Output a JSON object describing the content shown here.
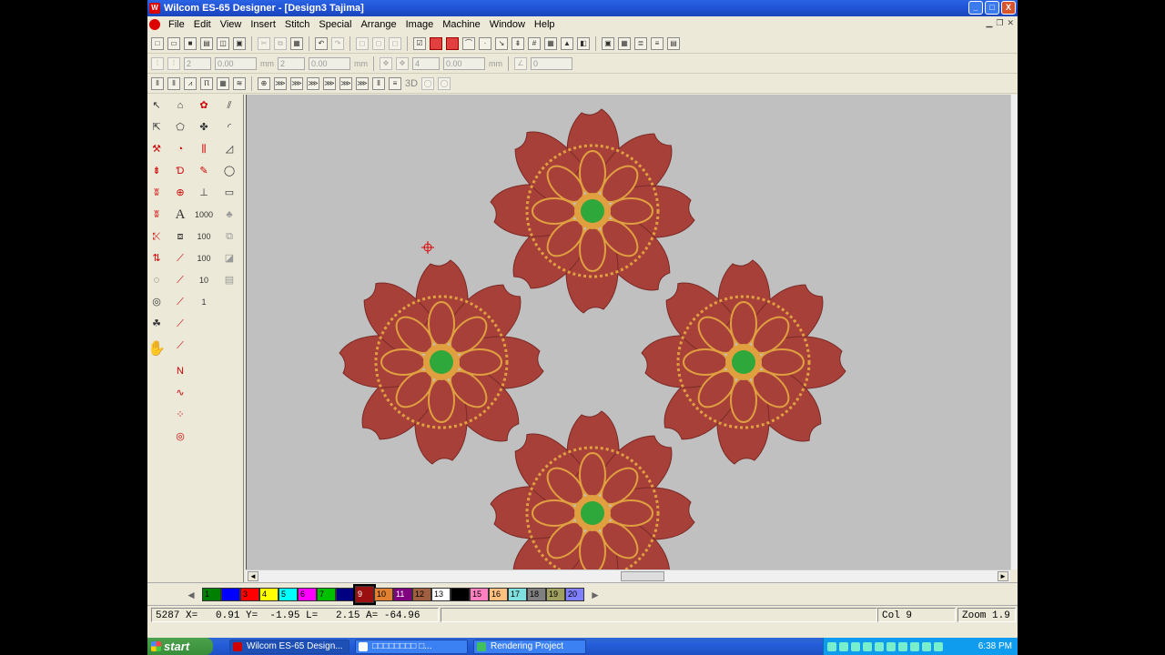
{
  "window": {
    "title": "Wilcom ES-65 Designer - [Design3        Tajima]",
    "minimize": "_",
    "maximize": "□",
    "close": "X"
  },
  "menu": [
    "File",
    "Edit",
    "View",
    "Insert",
    "Stitch",
    "Special",
    "Arrange",
    "Image",
    "Machine",
    "Window",
    "Help"
  ],
  "property_bar": {
    "spacing_1": "2",
    "length_1": "0.00",
    "unit_1": "mm",
    "spacing_2": "2",
    "length_2": "0.00",
    "unit_2": "mm",
    "spacing_3": "4",
    "length_3": "0.00",
    "unit_3": "mm",
    "angle": "0"
  },
  "stitch_toolbar": {
    "label_3d": "3D"
  },
  "toolbox": {
    "text_tool": "A",
    "count_1000": "1000",
    "count_100_a": "100",
    "count_100_b": "100",
    "count_10": "10",
    "count_1": "1"
  },
  "canvas": {
    "background": "#c0c0c0",
    "thread_red": "#a8403a",
    "thread_gold": "#e0a040",
    "thread_green": "#2ea83a"
  },
  "palette": {
    "swatches": [
      {
        "label": "1",
        "color": "#008000"
      },
      {
        "label": "",
        "color": "#0000ff"
      },
      {
        "label": "3",
        "color": "#ff0000"
      },
      {
        "label": "4",
        "color": "#ffff00"
      },
      {
        "label": "5",
        "color": "#00ffff"
      },
      {
        "label": "6",
        "color": "#ff00ff"
      },
      {
        "label": "7",
        "color": "#00c000"
      },
      {
        "label": "",
        "color": "#000080"
      },
      {
        "label": "9",
        "color": "#9a1010"
      },
      {
        "label": "10",
        "color": "#e08030"
      },
      {
        "label": "11",
        "color": "#800080"
      },
      {
        "label": "12",
        "color": "#a06040"
      },
      {
        "label": "13",
        "color": "#ffffff"
      },
      {
        "label": "",
        "color": "#000000"
      },
      {
        "label": "15",
        "color": "#ff80c0"
      },
      {
        "label": "16",
        "color": "#ffc080"
      },
      {
        "label": "17",
        "color": "#80e0e0"
      },
      {
        "label": "18",
        "color": "#808080"
      },
      {
        "label": "19",
        "color": "#a0a060"
      },
      {
        "label": "20",
        "color": "#8080ff"
      }
    ],
    "selected_index": 8,
    "prev": "◄",
    "next": "►"
  },
  "status": {
    "coords": "5287 X=   0.91 Y=  -1.95 L=   2.15 A= -64.96",
    "col": "Col 9",
    "zoom": "Zoom 1.9"
  },
  "taskbar": {
    "start": "start",
    "tasks": [
      {
        "label": "Wilcom ES-65 Design...",
        "active": true,
        "icon_color": "#d00000"
      },
      {
        "label": "□□□□□□□□ □...",
        "active": false,
        "icon_color": "#ffffff"
      },
      {
        "label": "Rendering Project",
        "active": false,
        "icon_color": "#40c060"
      }
    ],
    "clock": "6:38 PM"
  }
}
